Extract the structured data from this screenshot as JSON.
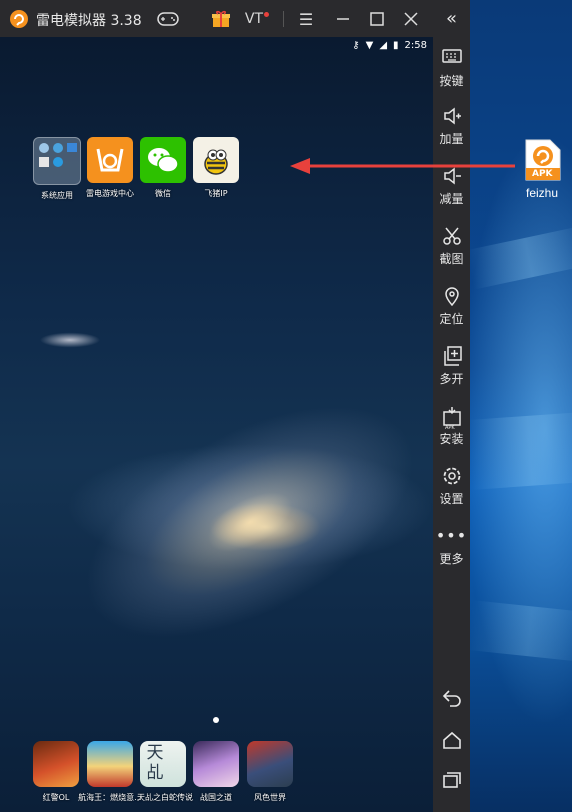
{
  "window": {
    "title": "雷电模拟器 3.38",
    "vt_label": "VT"
  },
  "status_bar": {
    "time": "2:58"
  },
  "home_apps": [
    {
      "label": "系统应用",
      "icon": "folder-icon"
    },
    {
      "label": "雷电游戏中心",
      "icon": "game-center-icon"
    },
    {
      "label": "微信",
      "icon": "wechat-icon"
    },
    {
      "label": "飞猪IP",
      "icon": "bee-icon"
    }
  ],
  "dock_apps": [
    {
      "label": "红警OL",
      "icon": "game-icon"
    },
    {
      "label": "航海王：燃烧意...",
      "icon": "game-icon"
    },
    {
      "label": "天乩之白蛇传说",
      "icon": "game-icon",
      "icon_text": "天乩"
    },
    {
      "label": "战国之道",
      "icon": "game-icon"
    },
    {
      "label": "风色世界",
      "icon": "game-icon"
    }
  ],
  "sidebar": {
    "items": [
      {
        "label": "按键",
        "icon": "keyboard-icon"
      },
      {
        "label": "加量",
        "icon": "volume-up-icon"
      },
      {
        "label": "减量",
        "icon": "volume-down-icon"
      },
      {
        "label": "截图",
        "icon": "scissors-icon"
      },
      {
        "label": "定位",
        "icon": "location-icon"
      },
      {
        "label": "多开",
        "icon": "multi-open-icon"
      },
      {
        "label": "安装",
        "icon": "install-apk-icon",
        "badge": "APK"
      },
      {
        "label": "设置",
        "icon": "gear-icon"
      },
      {
        "label": "更多",
        "icon": "more-icon"
      }
    ]
  },
  "desktop_file": {
    "label": "feizhu",
    "badge": "APK"
  },
  "colors": {
    "accent_orange": "#f5911e",
    "titlebar": "#2a2a2d",
    "arrow": "#e8413c",
    "wechat_green": "#2dc100"
  }
}
